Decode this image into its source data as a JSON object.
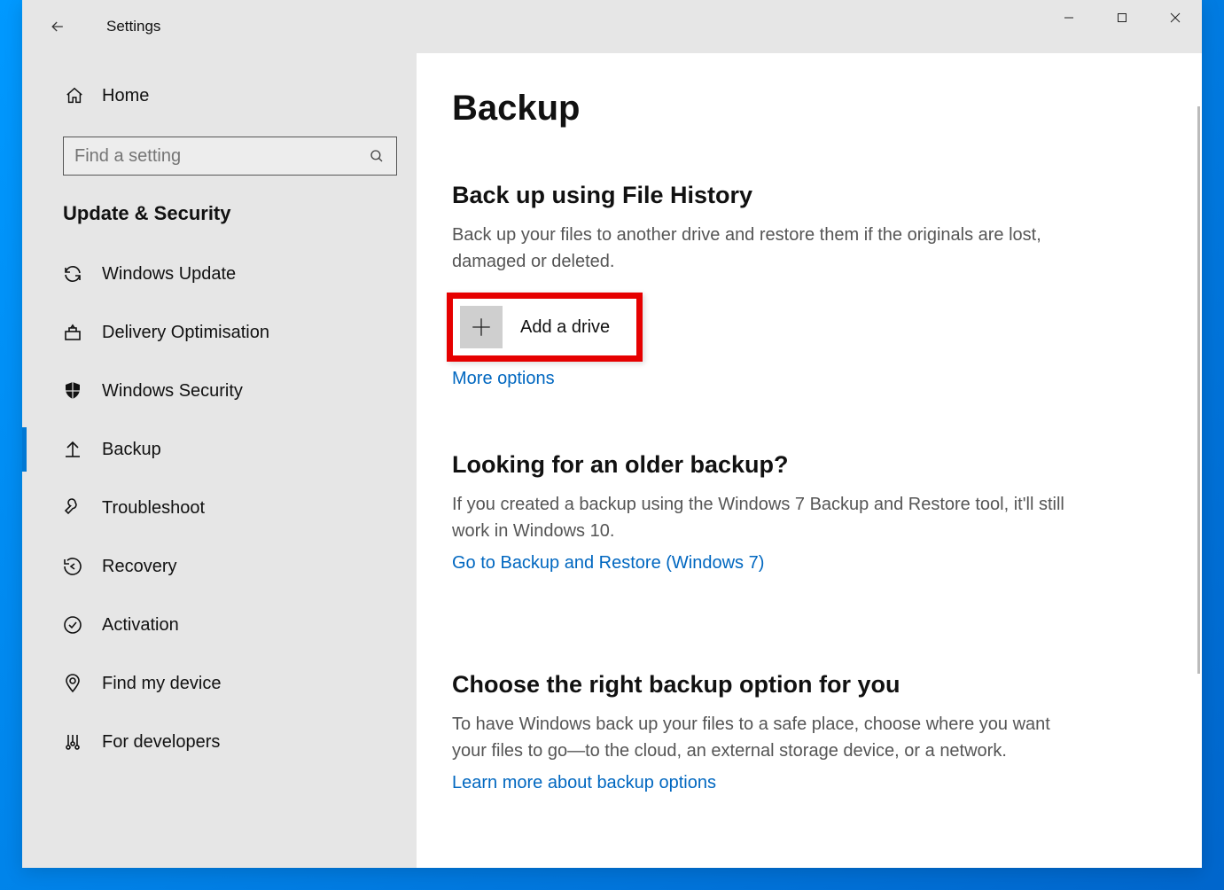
{
  "window": {
    "title": "Settings"
  },
  "sidebar": {
    "home": "Home",
    "search_placeholder": "Find a setting",
    "section": "Update & Security",
    "items": [
      {
        "label": "Windows Update"
      },
      {
        "label": "Delivery Optimisation"
      },
      {
        "label": "Windows Security"
      },
      {
        "label": "Backup"
      },
      {
        "label": "Troubleshoot"
      },
      {
        "label": "Recovery"
      },
      {
        "label": "Activation"
      },
      {
        "label": "Find my device"
      },
      {
        "label": "For developers"
      }
    ]
  },
  "main": {
    "title": "Backup",
    "filehistory": {
      "heading": "Back up using File History",
      "desc": "Back up your files to another drive and restore them if the originals are lost, damaged or deleted.",
      "add_drive": "Add a drive",
      "more_options": "More options"
    },
    "older": {
      "heading": "Looking for an older backup?",
      "desc": "If you created a backup using the Windows 7 Backup and Restore tool, it'll still work in Windows 10.",
      "link": "Go to Backup and Restore (Windows 7)"
    },
    "choose": {
      "heading": "Choose the right backup option for you",
      "desc": "To have Windows back up your files to a safe place, choose where you want your files to go—to the cloud, an external storage device, or a network.",
      "link": "Learn more about backup options"
    }
  }
}
